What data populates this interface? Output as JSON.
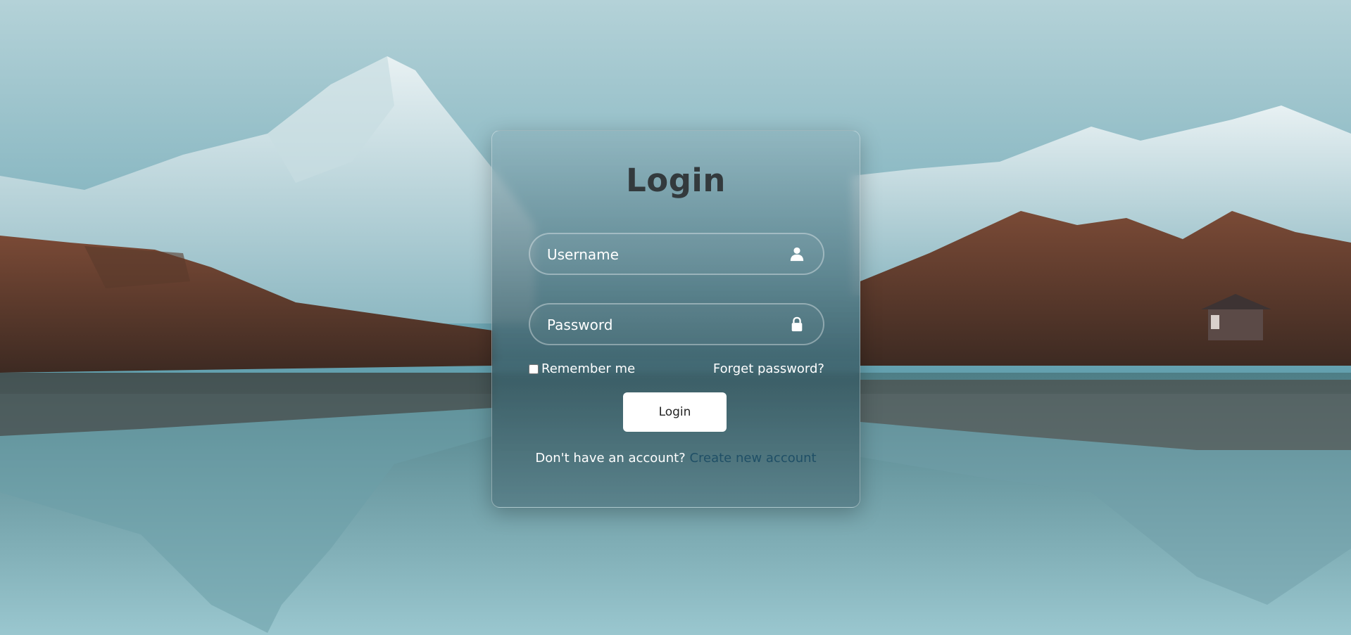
{
  "login_card": {
    "title": "Login",
    "username": {
      "placeholder": "Username",
      "value": "",
      "icon": "user-icon"
    },
    "password": {
      "placeholder": "Password",
      "value": "",
      "icon": "lock-icon"
    },
    "remember_label": "Remember me",
    "remember_checked": false,
    "forgot_label": "Forget password?",
    "login_button_label": "Login",
    "signup_prompt": "Don't have an account?",
    "signup_link": "Create new account"
  },
  "colors": {
    "title": "#333a3d",
    "link": "#1f4f66",
    "button_bg": "#ffffff"
  }
}
